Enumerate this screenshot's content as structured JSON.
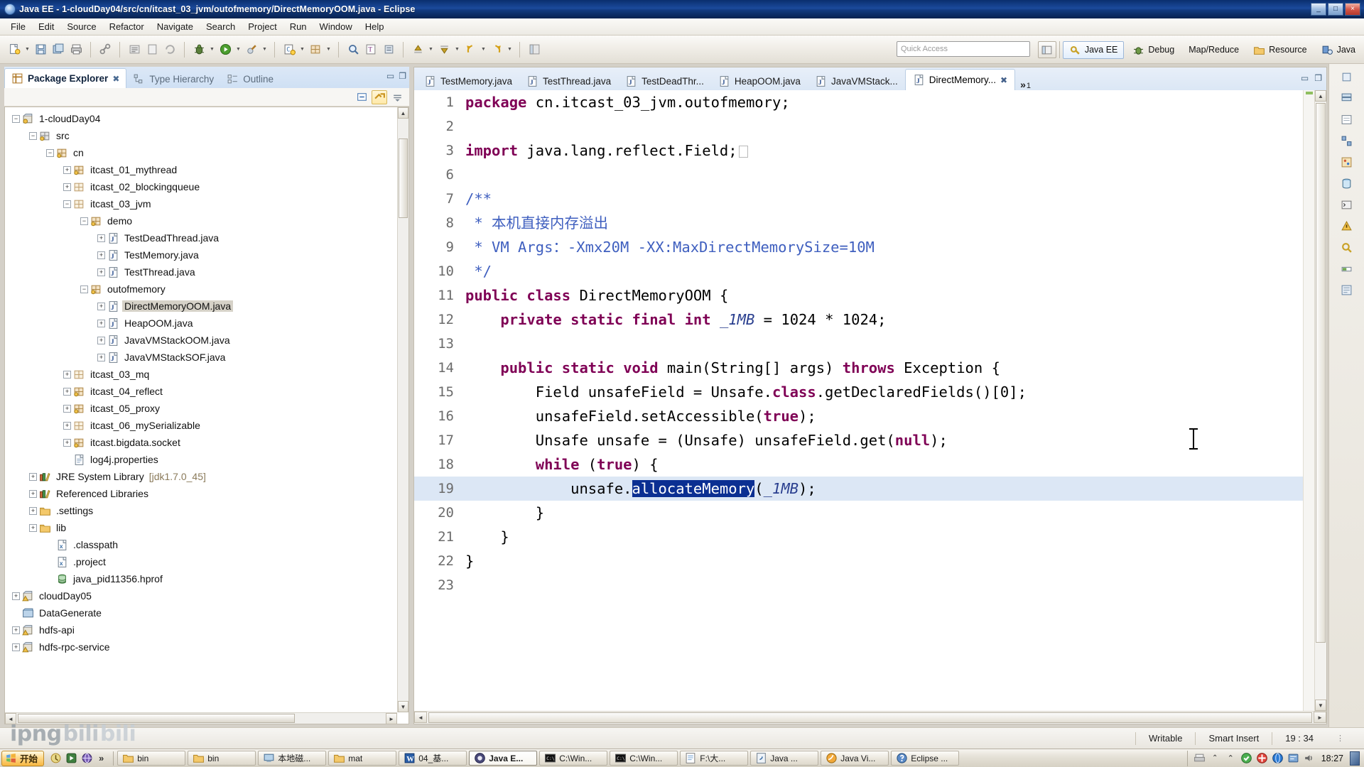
{
  "window": {
    "title": "Java EE - 1-cloudDay04/src/cn/itcast_03_jvm/outofmemory/DirectMemoryOOM.java - Eclipse",
    "minimize": "_",
    "maximize": "□",
    "close": "×"
  },
  "menubar": {
    "items": [
      "File",
      "Edit",
      "Source",
      "Refactor",
      "Navigate",
      "Search",
      "Project",
      "Run",
      "Window",
      "Help"
    ]
  },
  "toolbar": {
    "quick_access_placeholder": "Quick Access",
    "perspectives": [
      {
        "label": "Java EE",
        "icon": "java-ee-perspective-icon",
        "active": true
      },
      {
        "label": "Debug",
        "icon": "debug-perspective-icon",
        "active": false
      },
      {
        "label": "Map/Reduce",
        "icon": "mapreduce-perspective-icon",
        "active": false
      },
      {
        "label": "Resource",
        "icon": "resource-perspective-icon",
        "active": false
      },
      {
        "label": "Java",
        "icon": "java-perspective-icon",
        "active": false
      }
    ]
  },
  "left_view": {
    "tabs": [
      {
        "label": "Package Explorer",
        "icon": "package-explorer-icon",
        "active": true,
        "closable": true
      },
      {
        "label": "Type Hierarchy",
        "icon": "type-hierarchy-icon",
        "active": false,
        "closable": false
      },
      {
        "label": "Outline",
        "icon": "outline-icon",
        "active": false,
        "closable": false
      }
    ],
    "toolbar": [
      {
        "name": "collapse-all-button",
        "icon": "collapse-all-icon"
      },
      {
        "name": "link-with-editor-button",
        "icon": "link-editor-icon",
        "selected": true
      },
      {
        "name": "view-menu-button",
        "icon": "view-menu-icon"
      }
    ],
    "tree": [
      {
        "label": "1-cloudDay04",
        "depth": 0,
        "twist": "minus",
        "icon": "java-project-icon"
      },
      {
        "label": "src",
        "depth": 1,
        "twist": "minus",
        "icon": "source-folder-icon"
      },
      {
        "label": "cn",
        "depth": 2,
        "twist": "minus",
        "icon": "package-icon"
      },
      {
        "label": "itcast_01_mythread",
        "depth": 3,
        "twist": "plus",
        "icon": "package-icon"
      },
      {
        "label": "itcast_02_blockingqueue",
        "depth": 3,
        "twist": "plus",
        "icon": "package-empty-icon"
      },
      {
        "label": "itcast_03_jvm",
        "depth": 3,
        "twist": "minus",
        "icon": "package-empty-icon"
      },
      {
        "label": "demo",
        "depth": 4,
        "twist": "minus",
        "icon": "package-icon"
      },
      {
        "label": "TestDeadThread.java",
        "depth": 5,
        "twist": "plus",
        "icon": "java-file-icon"
      },
      {
        "label": "TestMemory.java",
        "depth": 5,
        "twist": "plus",
        "icon": "java-file-icon"
      },
      {
        "label": "TestThread.java",
        "depth": 5,
        "twist": "plus",
        "icon": "java-file-icon"
      },
      {
        "label": "outofmemory",
        "depth": 4,
        "twist": "minus",
        "icon": "package-icon"
      },
      {
        "label": "DirectMemoryOOM.java",
        "depth": 5,
        "twist": "plus",
        "icon": "java-file-icon",
        "selected": true
      },
      {
        "label": "HeapOOM.java",
        "depth": 5,
        "twist": "plus",
        "icon": "java-file-icon"
      },
      {
        "label": "JavaVMStackOOM.java",
        "depth": 5,
        "twist": "plus",
        "icon": "java-file-icon"
      },
      {
        "label": "JavaVMStackSOF.java",
        "depth": 5,
        "twist": "plus",
        "icon": "java-file-icon"
      },
      {
        "label": "itcast_03_mq",
        "depth": 3,
        "twist": "plus",
        "icon": "package-empty-icon"
      },
      {
        "label": "itcast_04_reflect",
        "depth": 3,
        "twist": "plus",
        "icon": "package-icon"
      },
      {
        "label": "itcast_05_proxy",
        "depth": 3,
        "twist": "plus",
        "icon": "package-icon"
      },
      {
        "label": "itcast_06_mySerializable",
        "depth": 3,
        "twist": "plus",
        "icon": "package-empty-icon"
      },
      {
        "label": "itcast.bigdata.socket",
        "depth": 3,
        "twist": "plus",
        "icon": "package-icon"
      },
      {
        "label": "log4j.properties",
        "depth": 3,
        "twist": "none",
        "icon": "properties-file-icon"
      },
      {
        "label": "JRE System Library",
        "suffix": "[jdk1.7.0_45]",
        "depth": 1,
        "twist": "plus",
        "icon": "library-icon"
      },
      {
        "label": "Referenced Libraries",
        "depth": 1,
        "twist": "plus",
        "icon": "library-icon"
      },
      {
        "label": ".settings",
        "depth": 1,
        "twist": "plus",
        "icon": "folder-icon"
      },
      {
        "label": "lib",
        "depth": 1,
        "twist": "plus",
        "icon": "folder-icon"
      },
      {
        "label": ".classpath",
        "depth": 2,
        "twist": "none",
        "icon": "xml-file-icon"
      },
      {
        "label": ".project",
        "depth": 2,
        "twist": "none",
        "icon": "xml-file-icon"
      },
      {
        "label": "java_pid11356.hprof",
        "depth": 2,
        "twist": "none",
        "icon": "hprof-file-icon"
      },
      {
        "label": "cloudDay05",
        "depth": 0,
        "twist": "plus",
        "icon": "java-project-warning-icon"
      },
      {
        "label": "DataGenerate",
        "depth": 0,
        "twist": "none",
        "icon": "closed-project-icon"
      },
      {
        "label": "hdfs-api",
        "depth": 0,
        "twist": "plus",
        "icon": "java-project-warning-icon"
      },
      {
        "label": "hdfs-rpc-service",
        "depth": 0,
        "twist": "plus",
        "icon": "java-project-warning-icon"
      }
    ]
  },
  "editor": {
    "tabs": [
      {
        "label": "TestMemory.java",
        "active": false,
        "closable": false
      },
      {
        "label": "TestThread.java",
        "active": false,
        "closable": false
      },
      {
        "label": "TestDeadThr...",
        "active": false,
        "closable": false
      },
      {
        "label": "HeapOOM.java",
        "active": false,
        "closable": false
      },
      {
        "label": "JavaVMStack...",
        "active": false,
        "closable": false
      },
      {
        "label": "DirectMemory...",
        "active": true,
        "closable": true
      }
    ],
    "overflow_chevron": "»",
    "overflow_count": "1",
    "selection": "allocateMemory",
    "lines": [
      {
        "num": "1",
        "fold": "",
        "text": "package cn.itcast_03_jvm.outofmemory;"
      },
      {
        "num": "2",
        "fold": "",
        "text": ""
      },
      {
        "num": "3",
        "fold": "+",
        "text": "import java.lang.reflect.Field;"
      },
      {
        "num": "6",
        "fold": "",
        "text": ""
      },
      {
        "num": "7",
        "fold": "-",
        "text": "/**"
      },
      {
        "num": "8",
        "fold": "",
        "text": " * 本机直接内存溢出"
      },
      {
        "num": "9",
        "fold": "",
        "text": " * VM Args：-Xmx20M -XX:MaxDirectMemorySize=10M"
      },
      {
        "num": "10",
        "fold": "",
        "text": " */"
      },
      {
        "num": "11",
        "fold": "",
        "text": "public class DirectMemoryOOM {"
      },
      {
        "num": "12",
        "fold": "",
        "text": "    private static final int _1MB = 1024 * 1024;"
      },
      {
        "num": "13",
        "fold": "",
        "text": ""
      },
      {
        "num": "14",
        "fold": "-",
        "text": "    public static void main(String[] args) throws Exception {"
      },
      {
        "num": "15",
        "fold": "",
        "text": "        Field unsafeField = Unsafe.class.getDeclaredFields()[0];"
      },
      {
        "num": "16",
        "fold": "",
        "text": "        unsafeField.setAccessible(true);"
      },
      {
        "num": "17",
        "fold": "",
        "text": "        Unsafe unsafe = (Unsafe) unsafeField.get(null);"
      },
      {
        "num": "18",
        "fold": "",
        "text": "        while (true) {"
      },
      {
        "num": "19",
        "fold": "",
        "text": "            unsafe.allocateMemory(_1MB);",
        "highlight": true
      },
      {
        "num": "20",
        "fold": "",
        "text": "        }"
      },
      {
        "num": "21",
        "fold": "",
        "text": "    }"
      },
      {
        "num": "22",
        "fold": "",
        "text": "}"
      },
      {
        "num": "23",
        "fold": "",
        "text": ""
      }
    ]
  },
  "statusbar": {
    "watermark": "ipng",
    "watermark_b1": "bili",
    "watermark_b2": "bili",
    "writable": "Writable",
    "insert_mode": "Smart Insert",
    "position": "19 : 34"
  },
  "taskbar": {
    "start_label": "开始",
    "overflow": "»",
    "quick_launch": [
      {
        "name": "show-desktop-icon"
      },
      {
        "name": "media-player-icon"
      },
      {
        "name": "browser-icon"
      }
    ],
    "items": [
      {
        "label": "bin",
        "icon": "folder-icon",
        "active": false
      },
      {
        "label": "bin",
        "icon": "folder-icon",
        "active": false
      },
      {
        "label": "本地磁...",
        "icon": "computer-icon",
        "active": false
      },
      {
        "label": "mat",
        "icon": "folder-icon",
        "active": false
      },
      {
        "label": "04_基...",
        "icon": "word-icon",
        "active": false
      },
      {
        "label": "Java E...",
        "icon": "eclipse-icon",
        "active": true
      },
      {
        "label": "C:\\Win...",
        "icon": "cmd-icon",
        "active": false
      },
      {
        "label": "C:\\Win...",
        "icon": "cmd-icon",
        "active": false
      },
      {
        "label": "F:\\大...",
        "icon": "editor-icon",
        "active": false
      },
      {
        "label": "Java ...",
        "icon": "java-icon",
        "active": false
      },
      {
        "label": "Java Vi...",
        "icon": "javavisual-icon",
        "active": false
      },
      {
        "label": "Eclipse ...",
        "icon": "eclipse-help-icon",
        "active": false
      }
    ],
    "clock": "18:27"
  }
}
